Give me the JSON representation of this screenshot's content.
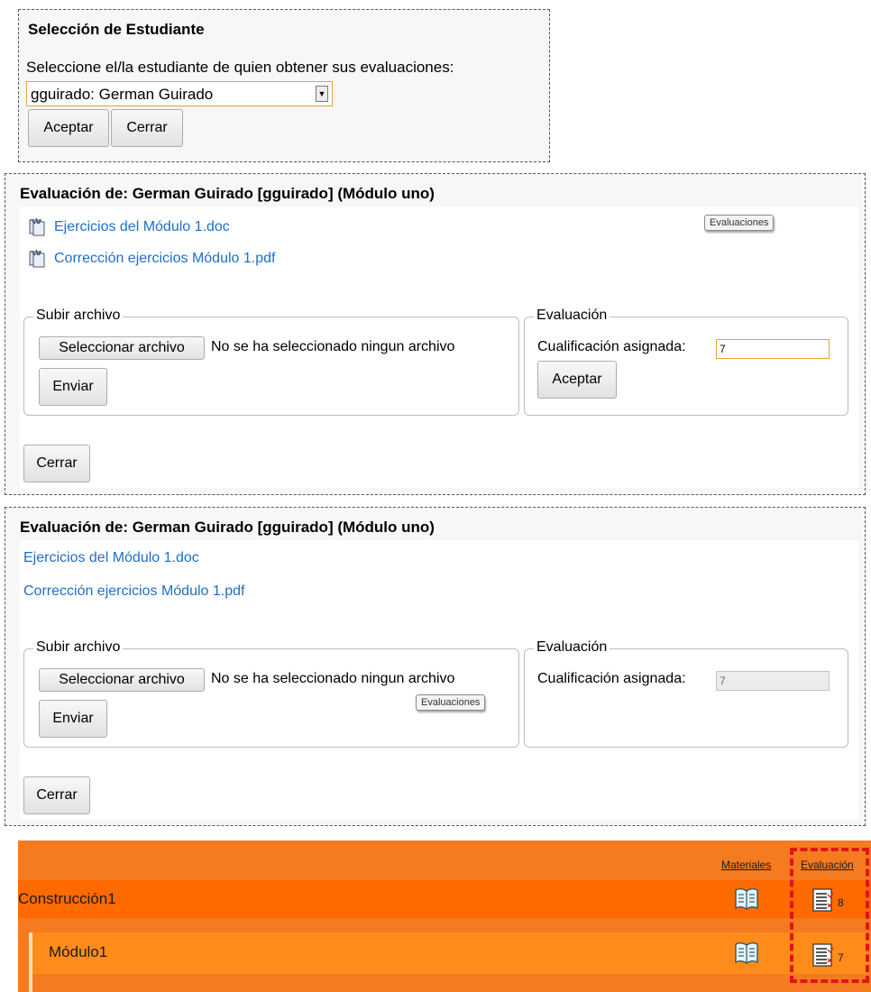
{
  "student_select": {
    "title": "Selección de Estudiante",
    "prompt": "Seleccione el/la estudiante de quien obtener sus evaluaciones:",
    "selected_student": "gguirado: German Guirado",
    "accept_label": "Aceptar",
    "close_label": "Cerrar"
  },
  "eval_panel_1": {
    "title": "Evaluación de: German Guirado [gguirado] (Módulo uno)",
    "files": [
      "Ejercicios del Módulo 1.doc",
      "Corrección ejercicios Módulo 1.pdf"
    ],
    "tooltip": "Evaluaciones",
    "upload": {
      "legend": "Subir archivo",
      "choose_label": "Seleccionar archivo",
      "no_file_text": "No se ha seleccionado ningun archivo",
      "send_label": "Enviar"
    },
    "evaluation": {
      "legend": "Evaluación",
      "grade_label": "Cualificación asignada:",
      "grade_value": "7",
      "accept_label": "Aceptar"
    },
    "close_label": "Cerrar"
  },
  "eval_panel_2": {
    "title": "Evaluación de: German Guirado [gguirado] (Módulo uno)",
    "files": [
      "Ejercicios del Módulo 1.doc",
      "Corrección ejercicios Módulo 1.pdf"
    ],
    "tooltip": "Evaluaciones",
    "upload": {
      "legend": "Subir archivo",
      "choose_label": "Seleccionar archivo",
      "no_file_text": "No se ha seleccionado ningun archivo",
      "send_label": "Enviar"
    },
    "evaluation": {
      "legend": "Evaluación",
      "grade_label": "Cualificación asignada:",
      "grade_value": "7"
    },
    "close_label": "Cerrar"
  },
  "course_list": {
    "col_materials": "Materiales",
    "col_evaluation": "Evaluación",
    "rows": [
      {
        "name": "Construcción1",
        "eval_count": "8"
      },
      {
        "name": "Módulo1",
        "eval_count": "7"
      }
    ],
    "colors": {
      "background": "#f47b20",
      "row_course": "#ff6a00",
      "row_module": "#ff8c1a",
      "highlight": "#e3141b"
    }
  }
}
